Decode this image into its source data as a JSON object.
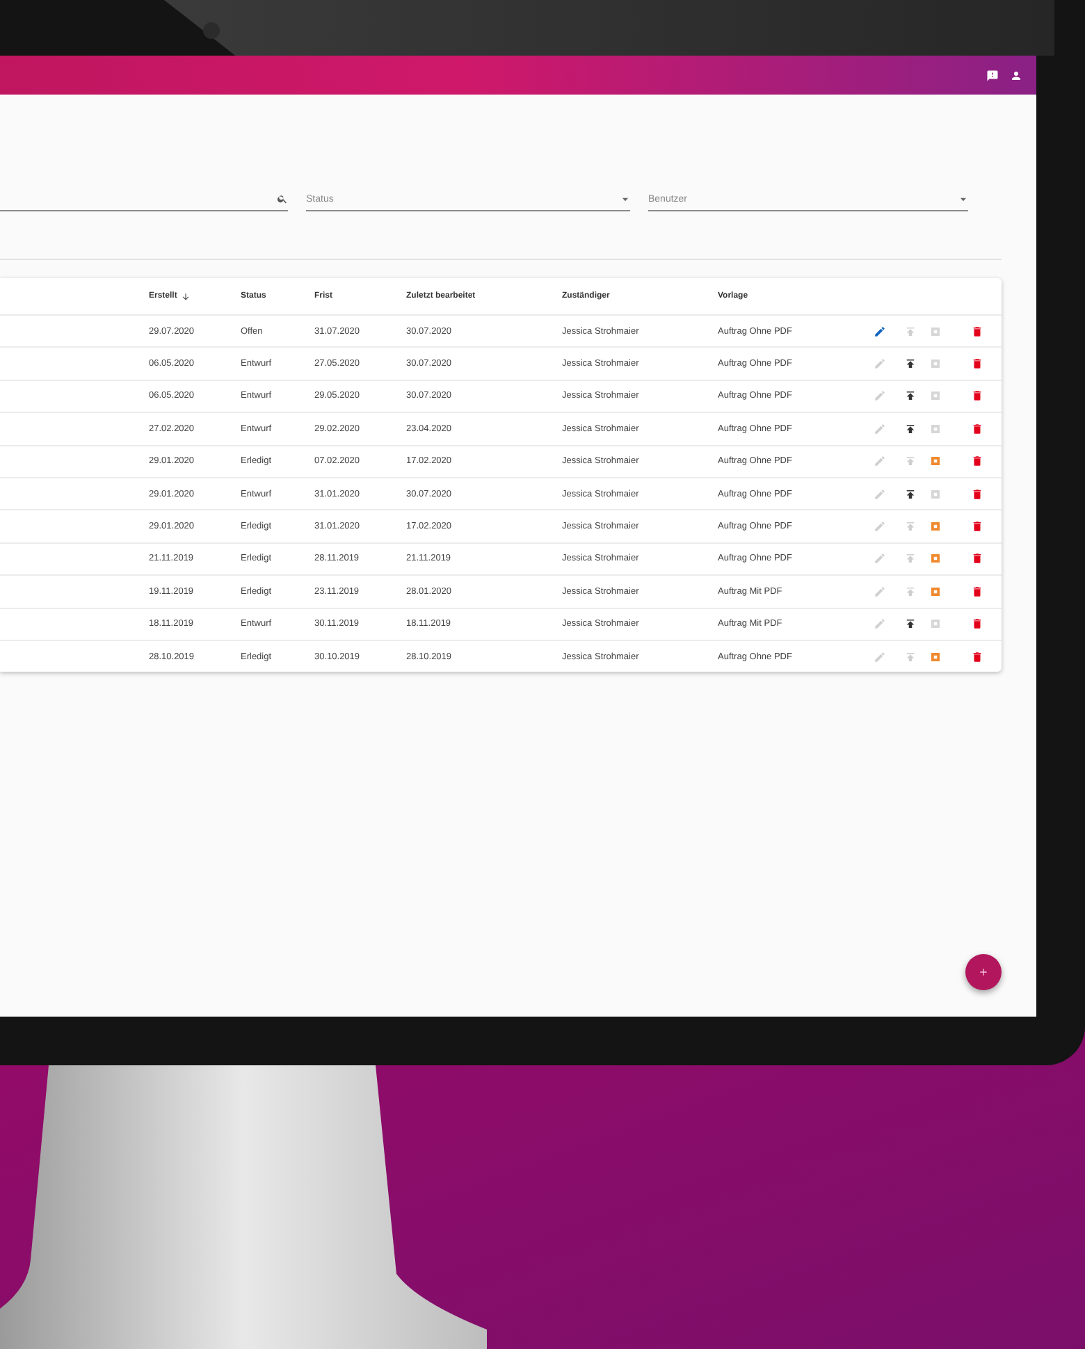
{
  "filters": [
    {
      "kind": "search"
    },
    {
      "kind": "select",
      "placeholder": "Status"
    },
    {
      "kind": "select",
      "placeholder": "Benutzer"
    }
  ],
  "table": {
    "columns": [
      {
        "label": "Erstellt",
        "sorted": true
      },
      {
        "label": "Status",
        "sorted": false
      },
      {
        "label": "Frist",
        "sorted": false
      },
      {
        "label": "Zuletzt bearbeitet",
        "sorted": false
      },
      {
        "label": "Zuständiger",
        "sorted": false
      },
      {
        "label": "Vorlage",
        "sorted": false
      }
    ],
    "rows": [
      {
        "cells": [
          "29.07.2020",
          "Offen",
          "31.07.2020",
          "30.07.2020",
          "Jessica Strohmaier",
          "Auftrag Ohne PDF"
        ],
        "edit_enabled": true,
        "upload_enabled": false,
        "pdf_enabled": false
      },
      {
        "cells": [
          "06.05.2020",
          "Entwurf",
          "27.05.2020",
          "30.07.2020",
          "Jessica Strohmaier",
          "Auftrag Ohne PDF"
        ],
        "edit_enabled": false,
        "upload_enabled": true,
        "pdf_enabled": false
      },
      {
        "cells": [
          "06.05.2020",
          "Entwurf",
          "29.05.2020",
          "30.07.2020",
          "Jessica Strohmaier",
          "Auftrag Ohne PDF"
        ],
        "edit_enabled": false,
        "upload_enabled": true,
        "pdf_enabled": false
      },
      {
        "cells": [
          "27.02.2020",
          "Entwurf",
          "29.02.2020",
          "23.04.2020",
          "Jessica Strohmaier",
          "Auftrag Ohne PDF"
        ],
        "edit_enabled": false,
        "upload_enabled": true,
        "pdf_enabled": false
      },
      {
        "cells": [
          "29.01.2020",
          "Erledigt",
          "07.02.2020",
          "17.02.2020",
          "Jessica Strohmaier",
          "Auftrag Ohne PDF"
        ],
        "edit_enabled": false,
        "upload_enabled": false,
        "pdf_enabled": true
      },
      {
        "cells": [
          "29.01.2020",
          "Entwurf",
          "31.01.2020",
          "30.07.2020",
          "Jessica Strohmaier",
          "Auftrag Ohne PDF"
        ],
        "edit_enabled": false,
        "upload_enabled": true,
        "pdf_enabled": false
      },
      {
        "cells": [
          "29.01.2020",
          "Erledigt",
          "31.01.2020",
          "17.02.2020",
          "Jessica Strohmaier",
          "Auftrag Ohne PDF"
        ],
        "edit_enabled": false,
        "upload_enabled": false,
        "pdf_enabled": true
      },
      {
        "cells": [
          "21.11.2019",
          "Erledigt",
          "28.11.2019",
          "21.11.2019",
          "Jessica Strohmaier",
          "Auftrag Ohne PDF"
        ],
        "edit_enabled": false,
        "upload_enabled": false,
        "pdf_enabled": true
      },
      {
        "cells": [
          "19.11.2019",
          "Erledigt",
          "23.11.2019",
          "28.01.2020",
          "Jessica Strohmaier",
          "Auftrag Mit PDF"
        ],
        "edit_enabled": false,
        "upload_enabled": false,
        "pdf_enabled": true
      },
      {
        "cells": [
          "18.11.2019",
          "Entwurf",
          "30.11.2019",
          "18.11.2019",
          "Jessica Strohmaier",
          "Auftrag Mit PDF"
        ],
        "edit_enabled": false,
        "upload_enabled": true,
        "pdf_enabled": false
      },
      {
        "cells": [
          "28.10.2019",
          "Erledigt",
          "30.10.2019",
          "28.10.2019",
          "Jessica Strohmaier",
          "Auftrag Ohne PDF"
        ],
        "edit_enabled": false,
        "upload_enabled": false,
        "pdf_enabled": true
      }
    ]
  }
}
